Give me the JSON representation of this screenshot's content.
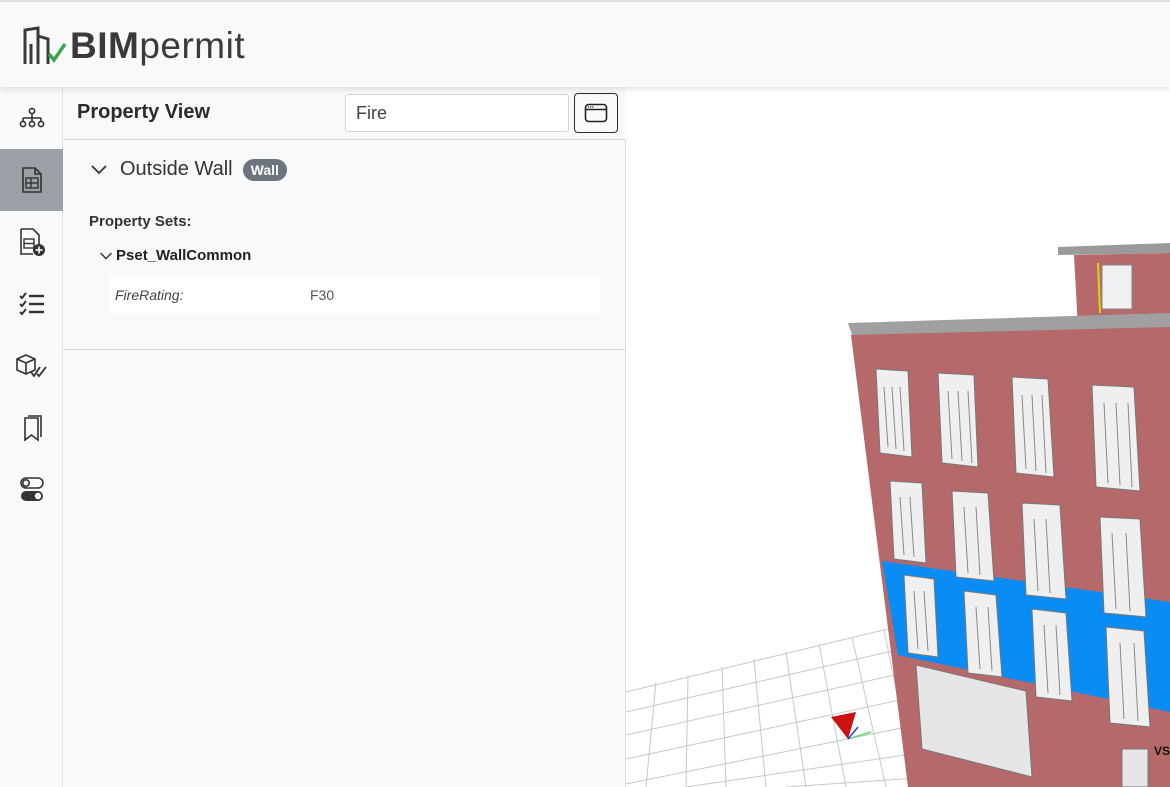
{
  "app": {
    "logo_bim": "BIM",
    "logo_permit": "permit"
  },
  "sidebar": {
    "items": [
      {
        "name": "hierarchy-icon",
        "active": false
      },
      {
        "name": "properties-document-icon",
        "active": true
      },
      {
        "name": "add-document-icon",
        "active": false
      },
      {
        "name": "checklist-icon",
        "active": false
      },
      {
        "name": "model-check-icon",
        "active": false
      },
      {
        "name": "bookmarks-icon",
        "active": false
      },
      {
        "name": "toggles-icon",
        "active": false
      }
    ]
  },
  "panel": {
    "title": "Property View",
    "search_value": "Fire",
    "window_button_icon": "window-icon",
    "element": {
      "name": "Outside Wall",
      "type_badge": "Wall"
    },
    "property_sets_label": "Property Sets:",
    "property_set": {
      "name": "Pset_WallCommon",
      "properties": [
        {
          "key": "FireRating:",
          "value": "F30"
        }
      ]
    }
  },
  "colors": {
    "accent_green": "#3aa54a",
    "highlight_blue": "#0a8cf5",
    "brick": "#b5696a",
    "active_sidebar": "#9aa0a6"
  }
}
